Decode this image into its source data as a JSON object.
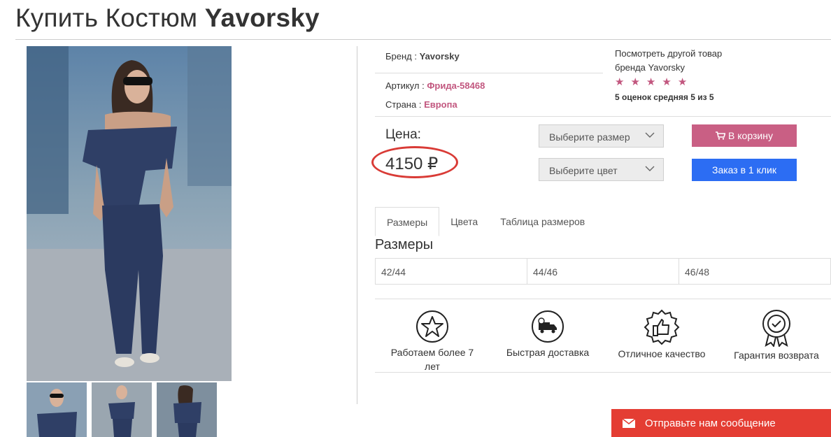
{
  "page": {
    "title_prefix": "Купить Костюм ",
    "title_brand": "Yavorsky"
  },
  "info": {
    "brand_label": "Бренд :",
    "brand_value": "Yavorsky",
    "article_label": "Артикул :",
    "article_value": "Фрида-58468",
    "country_label": "Страна :",
    "country_value": "Европа",
    "other_brand_line1": "Посмотреть другой товар",
    "other_brand_line2": "бренда",
    "other_brand_link": "Yavorsky"
  },
  "rating": {
    "stars": 5,
    "star_glyph": "★",
    "text_prefix": "5 оценок средняя",
    "text_avg": "5",
    "text_mid": "из",
    "text_max": "5"
  },
  "price": {
    "label": "Цена:",
    "value": "4150 ₽"
  },
  "selects": {
    "size_placeholder": "Выберите размер",
    "color_placeholder": "Выберите цвет"
  },
  "buttons": {
    "cart": "В корзину",
    "one_click": "Заказ в 1 клик"
  },
  "tabs": [
    {
      "label": "Размеры",
      "active": true
    },
    {
      "label": "Цвета",
      "active": false
    },
    {
      "label": "Таблица размеров",
      "active": false
    }
  ],
  "sizes": {
    "title": "Размеры",
    "items": [
      "42/44",
      "44/46",
      "46/48"
    ]
  },
  "features": [
    {
      "label": "Работаем более 7 лет",
      "icon": "star-badge-icon"
    },
    {
      "label": "Быстрая доставка",
      "icon": "delivery-truck-icon"
    },
    {
      "label": "Отличное качество",
      "icon": "thumbs-up-seal-icon"
    },
    {
      "label": "Гарантия возврата",
      "icon": "guarantee-medal-icon"
    }
  ],
  "message_bar": {
    "label": "Отправьте нам сообщение",
    "icon": "envelope-icon"
  },
  "colors": {
    "accent_pink": "#c95f84",
    "link_pink": "#c2577f",
    "blue_button": "#2c6df3",
    "message_red": "#e43d33",
    "price_circle": "#d93b36"
  }
}
